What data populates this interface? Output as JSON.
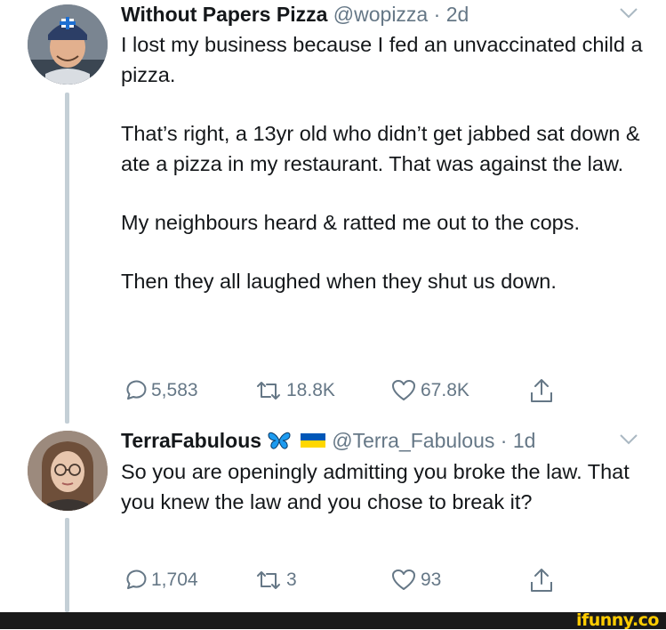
{
  "tweets": [
    {
      "name": "Without Papers Pizza",
      "handle": "@wopizza",
      "separator": "·",
      "time": "2d",
      "paragraphs": [
        "I lost my business because I fed an unvaccinated child a pizza.",
        "That’s right, a 13yr old who didn’t get jabbed sat down & ate a pizza in my restaurant. That was against the law.",
        "My neighbours heard & ratted me out to the cops.",
        "Then they all laughed when they shut us down."
      ],
      "replies": "5,583",
      "retweets": "18.8K",
      "likes": "67.8K"
    },
    {
      "name": "TerraFabulous",
      "name_emojis": [
        "butterfly-emoji",
        "ukraine-flag-emoji"
      ],
      "handle": "@Terra_Fabulous",
      "separator": "·",
      "time": "1d",
      "paragraphs": [
        "So you are openingly admitting you broke the law. That you knew the law and you chose to break it?"
      ],
      "replies": "1,704",
      "retweets": "3",
      "likes": "93"
    }
  ],
  "icons": [
    "chevron-down-icon",
    "reply-icon",
    "retweet-icon",
    "like-icon",
    "share-icon"
  ],
  "colors": {
    "text": "#14171a",
    "muted": "#657786",
    "thread_line": "#c4cfd6",
    "butterfly": "#1d9bf0",
    "flag_blue": "#0057b7",
    "flag_yellow": "#ffd700",
    "watermark": "#ffcc00"
  },
  "watermark": "ifunny.co"
}
